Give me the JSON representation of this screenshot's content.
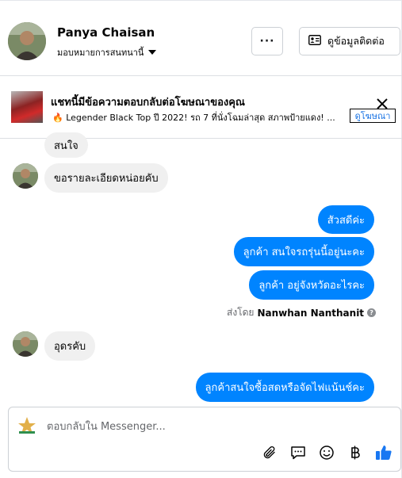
{
  "header": {
    "name": "Panya Chaisan",
    "assign_label": "มอบหมายการสนทนานี้",
    "more_label": "···",
    "contact_label": "ดูข้อมูลติดต่อ"
  },
  "ad": {
    "title": "แชทนี้มีข้อความตอบกลับต่อโฆษณาของคุณ",
    "description": "🔥 Legender Black Top ปี 2022! รถ 7 ที่นั่งโฉมล่าสุด สภาพป้ายแดง! ...",
    "link_label": "ดูโฆษณา"
  },
  "messages": [
    {
      "from": "customer",
      "text": "สนใจ"
    },
    {
      "from": "customer",
      "text": "ขอรายละเอียดหน่อยคับ"
    },
    {
      "from": "page",
      "text": "สัวสดีค่ะ"
    },
    {
      "from": "page",
      "text": "ลูกค้า สนใจรถรุ่นนี้อยู่นะคะ"
    },
    {
      "from": "page",
      "text": "ลูกค้า อยู่จังหวัดอะไรคะ"
    },
    {
      "from": "customer",
      "text": "อุดรคับ"
    },
    {
      "from": "page",
      "text": "ลูกค้าสนใจซื้อสดหรือจัดไฟแน้นช์คะ"
    }
  ],
  "sent_by": {
    "prefix": "ส่งโดย",
    "name": "Nanwhan Nanthanit"
  },
  "composer": {
    "placeholder": "ตอบกลับใน Messenger..."
  },
  "tools": [
    "paperclip-icon",
    "speech-bubble-icon",
    "emoji-icon",
    "baht-icon",
    "thumbs-up-icon"
  ],
  "colors": {
    "outgoing": "#0084ff",
    "incoming": "#f0f0f0",
    "link": "#1b74e4"
  }
}
